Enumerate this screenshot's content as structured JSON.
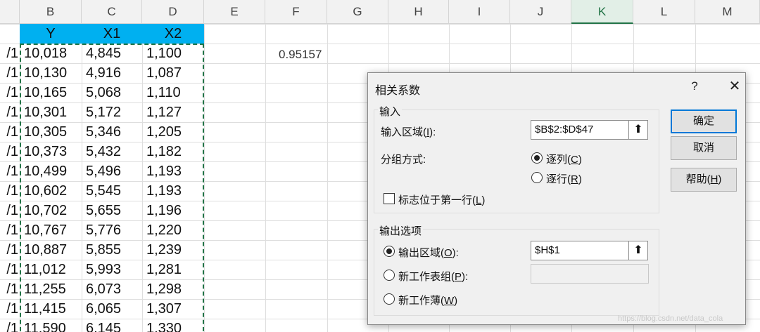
{
  "sheet": {
    "columns": [
      "B",
      "C",
      "D",
      "E",
      "F",
      "G",
      "H",
      "I",
      "J",
      "K",
      "L",
      "M"
    ],
    "active_column": "K",
    "headers": [
      "Y",
      "X1",
      "X2"
    ],
    "a_col_fragments": [
      "/1",
      "/1",
      "/1",
      "/1",
      "/1",
      "/1",
      "/1",
      "/1",
      "/1",
      "/1",
      "/1",
      "/1",
      "/1",
      "/1",
      "/1"
    ],
    "rows": [
      [
        "10,018",
        "4,845",
        "1,100"
      ],
      [
        "10,130",
        "4,916",
        "1,087"
      ],
      [
        "10,165",
        "5,068",
        "1,110"
      ],
      [
        "10,301",
        "5,172",
        "1,127"
      ],
      [
        "10,305",
        "5,346",
        "1,205"
      ],
      [
        "10,373",
        "5,432",
        "1,182"
      ],
      [
        "10,499",
        "5,496",
        "1,193"
      ],
      [
        "10,602",
        "5,545",
        "1,193"
      ],
      [
        "10,702",
        "5,655",
        "1,196"
      ],
      [
        "10,767",
        "5,776",
        "1,220"
      ],
      [
        "10,887",
        "5,855",
        "1,239"
      ],
      [
        "11,012",
        "5,993",
        "1,281"
      ],
      [
        "11,255",
        "6,073",
        "1,298"
      ],
      [
        "11,415",
        "6,065",
        "1,307"
      ],
      [
        "11,590",
        "6,145",
        "1,330"
      ]
    ],
    "f1_value": "0.95157",
    "header_fill_color": "#00b0f0",
    "marquee_color": "#217346"
  },
  "dialog": {
    "title": "相关系数",
    "help_glyph": "?",
    "close_glyph": "✕",
    "input_group": {
      "title": "输入",
      "range_label_pre": "输入区域(",
      "range_label_key": "I",
      "range_label_post": "):",
      "range_value": "$B$2:$D$47",
      "group_by_label": "分组方式:",
      "by_columns_pre": "逐列(",
      "by_columns_key": "C",
      "by_columns_post": ")",
      "by_columns_selected": true,
      "by_rows_pre": "逐行(",
      "by_rows_key": "R",
      "by_rows_post": ")",
      "labels_first_row_pre": "标志位于第一行(",
      "labels_first_row_key": "L",
      "labels_first_row_post": ")",
      "labels_first_row_checked": false
    },
    "output_group": {
      "title": "输出选项",
      "output_range_pre": "输出区域(",
      "output_range_key": "O",
      "output_range_post": "):",
      "output_range_value": "$H$1",
      "output_range_selected": true,
      "new_sheet_pre": "新工作表组(",
      "new_sheet_key": "P",
      "new_sheet_post": "):",
      "new_sheet_value": "",
      "new_workbook_pre": "新工作薄(",
      "new_workbook_key": "W",
      "new_workbook_post": ")"
    },
    "buttons": {
      "ok": "确定",
      "cancel": "取消",
      "help_pre": "帮助(",
      "help_key": "H",
      "help_post": ")"
    },
    "ref_glyph": "⬆"
  },
  "watermark": "https://blog.csdn.net/data_cola"
}
